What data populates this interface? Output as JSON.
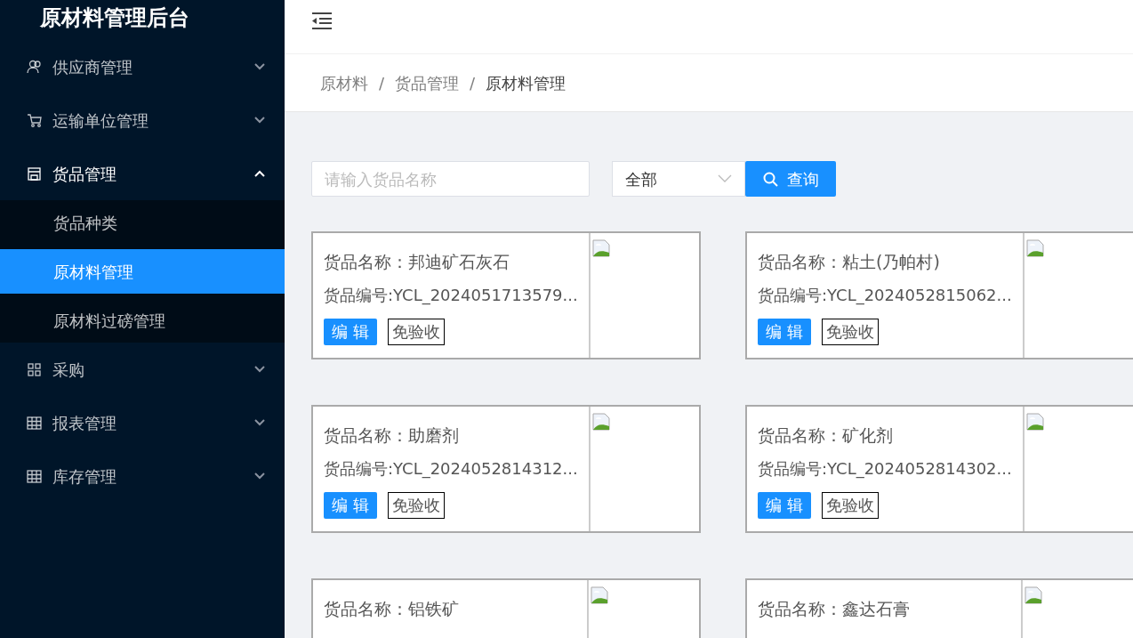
{
  "app_title": "原材料管理后台",
  "sidebar": {
    "items": [
      {
        "label": "供应商管理",
        "expanded": false
      },
      {
        "label": "运输单位管理",
        "expanded": false
      },
      {
        "label": "货品管理",
        "expanded": true,
        "children": [
          {
            "label": "货品种类",
            "selected": false
          },
          {
            "label": "原材料管理",
            "selected": true
          },
          {
            "label": "原材料过磅管理",
            "selected": false
          }
        ]
      },
      {
        "label": "采购",
        "expanded": false
      },
      {
        "label": "报表管理",
        "expanded": false
      },
      {
        "label": "库存管理",
        "expanded": false
      }
    ]
  },
  "breadcrumb": [
    {
      "label": "原材料"
    },
    {
      "separator": "/",
      "label": "货品管理"
    },
    {
      "separator": "/",
      "label": "原材料管理"
    }
  ],
  "search": {
    "placeholder": "请输入货品名称",
    "filter": "全部",
    "button": "查询"
  },
  "cards": [
    {
      "name": "货品名称：邦迪矿石灰石",
      "code": "货品编号:YCL_2024051713579...",
      "edit": "编 辑",
      "tag": "免验收"
    },
    {
      "name": "货品名称：粘土(乃帕村)",
      "code": "货品编号:YCL_2024052815062...",
      "edit": "编 辑",
      "tag": "免验收"
    },
    {
      "name": "货品名称：助磨剂",
      "code": "货品编号:YCL_2024052814312...",
      "edit": "编 辑",
      "tag": "免验收"
    },
    {
      "name": "货品名称：矿化剂",
      "code": "货品编号:YCL_2024052814302...",
      "edit": "编 辑",
      "tag": "免验收"
    },
    {
      "name": "货品名称：铝铁矿"
    },
    {
      "name": "货品名称：鑫达石膏"
    }
  ]
}
